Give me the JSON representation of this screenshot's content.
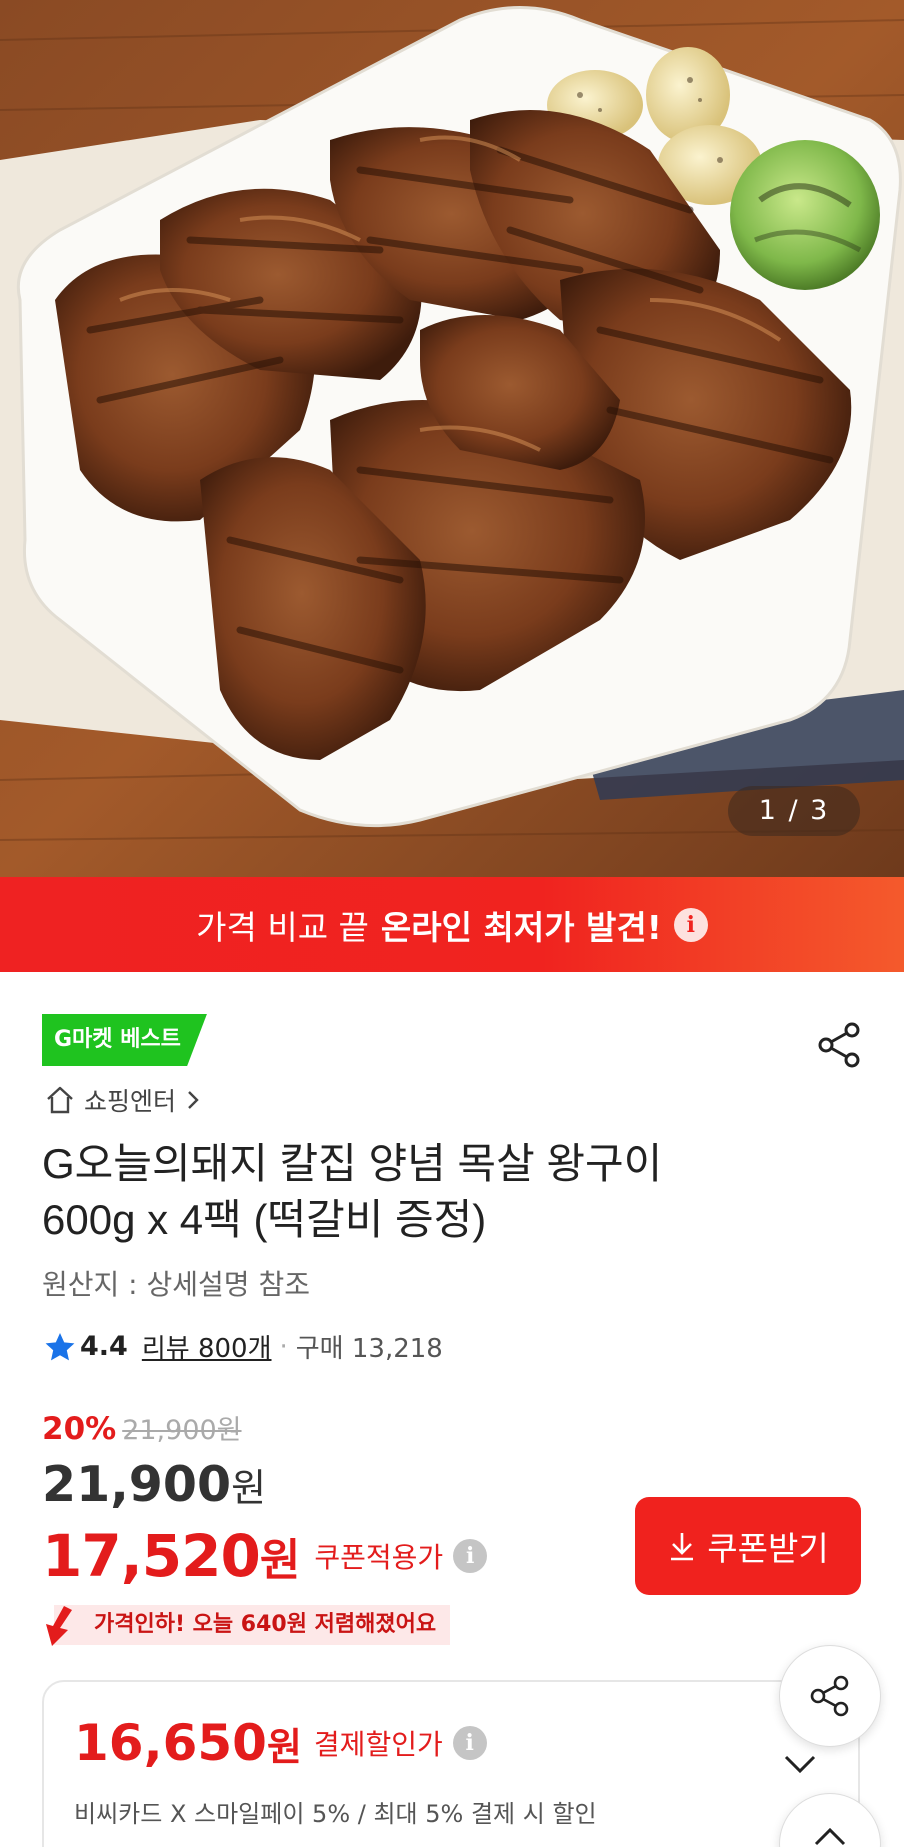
{
  "gallery": {
    "counter": "1 / 3"
  },
  "promo_banner": {
    "prefix": "가격 비교 끝",
    "highlight": "온라인 최저가 발견!",
    "info_icon": "info-icon"
  },
  "product": {
    "badge": "G마켓 베스트",
    "seller": "쇼핑엔터",
    "title_line1": "G오늘의돼지 칼집 양념 목살 왕구이",
    "title_line2": "600g x 4팩 (떡갈비 증정)",
    "origin": "원산지 : 상세설명 참조",
    "rating": "4.4",
    "reviews": "리뷰 800개",
    "purchases": "구매 13,218"
  },
  "pricing": {
    "discount_percent": "20%",
    "original_price": "21,900원",
    "price": "21,900",
    "price_unit": "원",
    "coupon_price": "17,520",
    "coupon_unit": "원",
    "coupon_label": "쿠폰적용가",
    "coupon_button": "쿠폰받기",
    "price_drop_note": "가격인하! 오늘 640원 저렴해졌어요",
    "pay_price": "16,650",
    "pay_unit": "원",
    "pay_label": "결제할인가",
    "pay_desc": "비씨카드 X 스마일페이 5%  / 최대 5% 결제 시 할인"
  },
  "colors": {
    "accent_red": "#f0221e",
    "badge_green": "#1fc31f",
    "rating_star": "#1a73e8"
  },
  "icons": [
    "share-icon",
    "home-icon",
    "chevron-right-icon",
    "star-icon",
    "info-icon",
    "download-icon",
    "price-down-arrow-icon",
    "chevron-down-icon",
    "arrow-up-icon"
  ]
}
